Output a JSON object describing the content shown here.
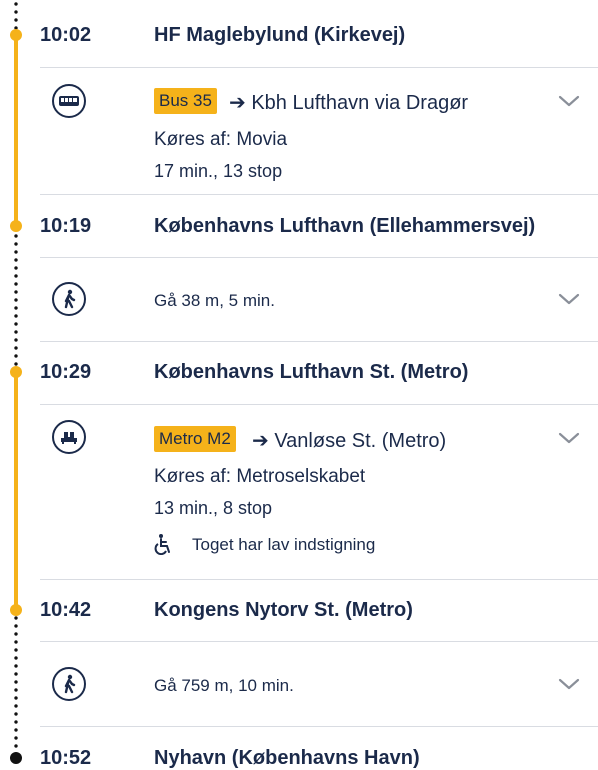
{
  "stops": [
    {
      "time": "10:02",
      "name": "HF Maglebylund (Kirkevej)"
    },
    {
      "time": "10:19",
      "name": "Københavns Lufthavn (Ellehammersvej)"
    },
    {
      "time": "10:29",
      "name": "Københavns Lufthavn St. (Metro)"
    },
    {
      "time": "10:42",
      "name": "Kongens Nytorv St. (Metro)"
    },
    {
      "time": "10:52",
      "name": "Nyhavn (Københavns Havn)"
    }
  ],
  "legs": [
    {
      "icon": "bus-icon",
      "line": "Bus 35",
      "destination": "➔ Kbh Lufthavn via Dragør",
      "operator": "Køres af: Movia",
      "duration": "17 min., 13 stop"
    },
    {
      "icon": "walk-icon",
      "text": "Gå 38 m, 5 min."
    },
    {
      "icon": "metro-icon",
      "line": "Metro M2",
      "destination": "➔ Vanløse St. (Metro)",
      "operator": "Køres af: Metroselskabet",
      "duration": "13 min., 8 stop",
      "accessibility": "Toget har lav indstigning"
    },
    {
      "icon": "walk-icon",
      "text": "Gå 759 m, 10 min."
    }
  ],
  "colors": {
    "accent": "#f5b21a",
    "text": "#1b2a4a",
    "separator": "#d9dce2"
  }
}
